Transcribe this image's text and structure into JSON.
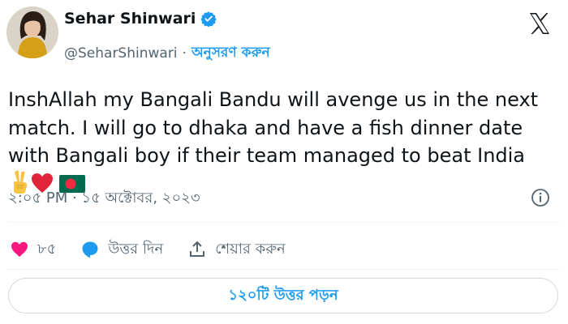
{
  "author": {
    "name": "Sehar Shinwari",
    "handle": "@SeharShinwari",
    "separator": "·",
    "follow_label": "অনুসরণ করুন"
  },
  "tweet": {
    "text": "InshAllah my Bangali Bandu will avenge us in the next match. I will go to dhaka and have a fish dinner date with Bangali boy if their team managed to beat India",
    "timestamp": "২:০৫ PM · ১৫ অক্টোবর, ২০২৩"
  },
  "actions": {
    "like_count": "৮৫",
    "reply_label": "উত্তর দিন",
    "share_label": "শেয়ার করুন"
  },
  "replies_button": "১২০টি উত্তর পড়ন",
  "colors": {
    "accent": "#1d9bf0",
    "text": "#0f1419",
    "secondary": "#536471",
    "like": "#f91880"
  },
  "icons": [
    "verified-badge-icon",
    "x-logo-icon",
    "victory-hand-emoji",
    "red-heart-emoji",
    "bangladesh-flag-emoji",
    "info-icon",
    "heart-icon",
    "reply-bubble-icon",
    "share-icon"
  ]
}
